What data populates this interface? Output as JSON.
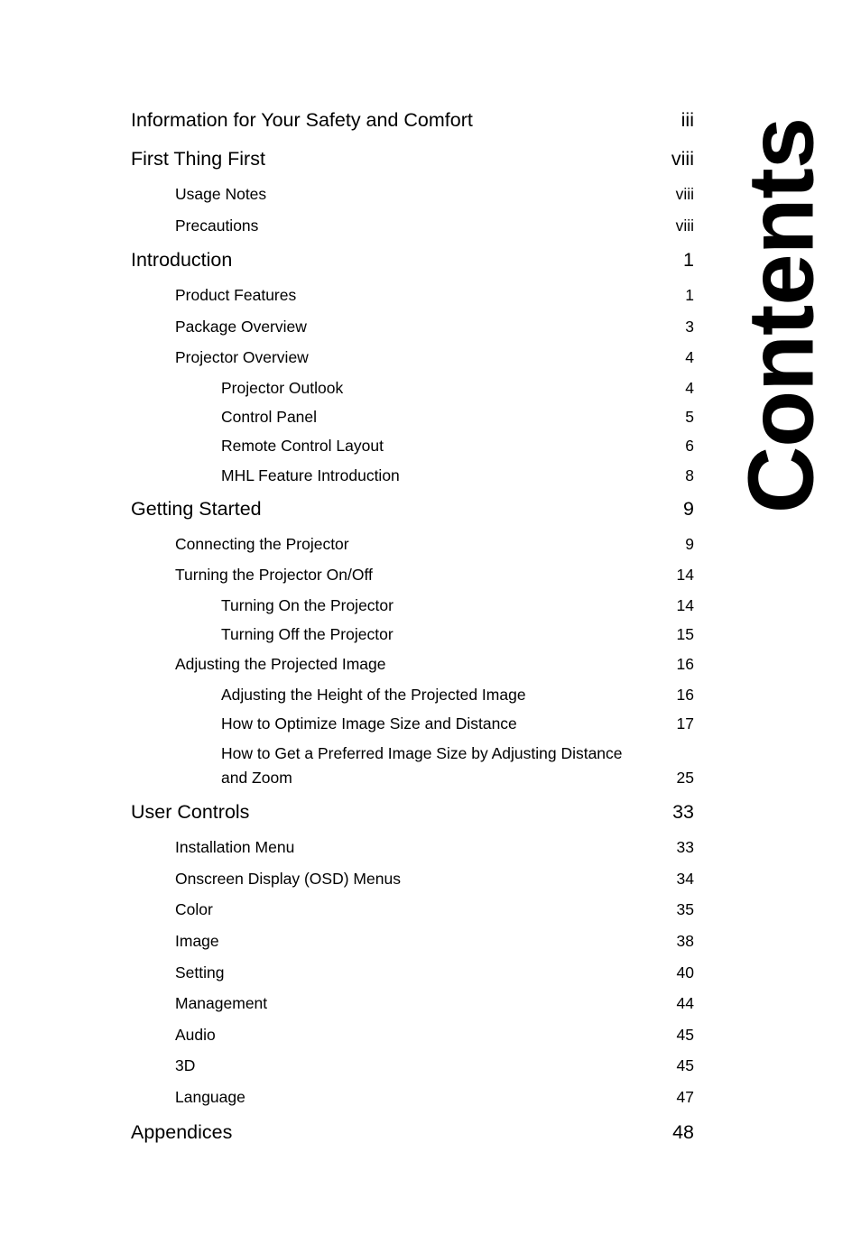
{
  "page": {
    "side_title": "Contents",
    "background_color": "#ffffff",
    "text_color": "#000000"
  },
  "toc": {
    "entries": [
      {
        "label": "Information for Your Safety and Comfort",
        "page": "iii",
        "level": 0
      },
      {
        "label": "First Thing First",
        "page": "viii",
        "level": 0
      },
      {
        "label": "Usage Notes",
        "page": "viii",
        "level": 1
      },
      {
        "label": "Precautions",
        "page": "viii",
        "level": 1
      },
      {
        "label": "Introduction",
        "page": "1",
        "level": 0
      },
      {
        "label": "Product Features",
        "page": "1",
        "level": 1
      },
      {
        "label": "Package Overview",
        "page": "3",
        "level": 1
      },
      {
        "label": "Projector Overview",
        "page": "4",
        "level": 1
      },
      {
        "label": "Projector Outlook",
        "page": "4",
        "level": 2
      },
      {
        "label": "Control Panel",
        "page": "5",
        "level": 2
      },
      {
        "label": "Remote Control Layout",
        "page": "6",
        "level": 2
      },
      {
        "label": "MHL Feature Introduction",
        "page": "8",
        "level": 2
      },
      {
        "label": "Getting Started",
        "page": "9",
        "level": 0
      },
      {
        "label": "Connecting the Projector",
        "page": "9",
        "level": 1
      },
      {
        "label": "Turning the Projector On/Off",
        "page": "14",
        "level": 1
      },
      {
        "label": "Turning On the Projector",
        "page": "14",
        "level": 2
      },
      {
        "label": "Turning Off the Projector",
        "page": "15",
        "level": 2
      },
      {
        "label": "Adjusting the Projected Image",
        "page": "16",
        "level": 1
      },
      {
        "label": "Adjusting the Height of the Projected Image",
        "page": "16",
        "level": 2
      },
      {
        "label": "How to Optimize Image Size and Distance",
        "page": "17",
        "level": 2
      },
      {
        "label": "How to Get a Preferred Image Size by Adjusting Distance and Zoom",
        "page": "25",
        "level": 2,
        "wrap": true
      },
      {
        "label": "User Controls",
        "page": "33",
        "level": 0
      },
      {
        "label": "Installation Menu",
        "page": "33",
        "level": 1
      },
      {
        "label": "Onscreen Display (OSD) Menus",
        "page": "34",
        "level": 1
      },
      {
        "label": "Color",
        "page": "35",
        "level": 1
      },
      {
        "label": "Image",
        "page": "38",
        "level": 1
      },
      {
        "label": "Setting",
        "page": "40",
        "level": 1
      },
      {
        "label": "Management",
        "page": "44",
        "level": 1
      },
      {
        "label": "Audio",
        "page": "45",
        "level": 1
      },
      {
        "label": "3D",
        "page": "45",
        "level": 1
      },
      {
        "label": "Language",
        "page": "47",
        "level": 1
      },
      {
        "label": "Appendices",
        "page": "48",
        "level": 0
      }
    ]
  }
}
